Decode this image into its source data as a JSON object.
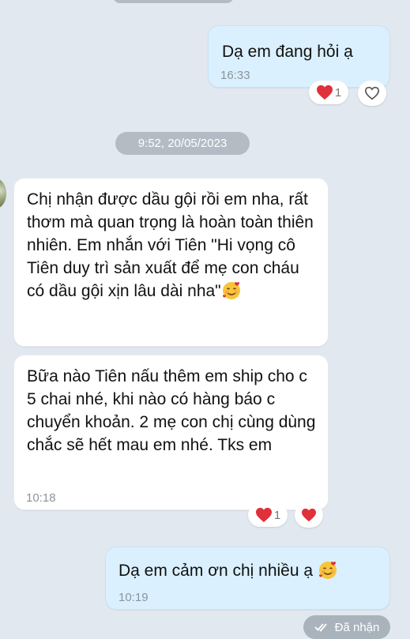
{
  "messages": {
    "m1": {
      "text": "Dạ em đang hỏi ạ",
      "time": "16:33",
      "reaction_count": "1"
    },
    "date_separator": "9:52, 20/05/2023",
    "m2": {
      "text": "Chị nhận được dầu gội rồi em nha, rất thơm mà quan trọng là hoàn toàn thiên nhiên. Em nhắn với Tiên \"Hi vọng cô Tiên duy trì sản xuất để mẹ con cháu có dầu gội xịn lâu dài nha\""
    },
    "m3": {
      "text": "Bữa nào Tiên nấu thêm em ship cho c 5 chai nhé, khi nào có hàng báo c chuyển khoản. 2 mẹ con chị cùng dùng chắc sẽ hết mau em nhé. Tks em",
      "time": "10:18",
      "reaction_count": "1"
    },
    "m4": {
      "text": "Dạ em cảm ơn chị nhiều ạ",
      "time": "10:19"
    },
    "status": "Đã nhận"
  },
  "colors": {
    "background": "#e2e8ef",
    "outgoing_bubble": "#daf0fe",
    "incoming_bubble": "#ffffff",
    "heart": "#e0303a",
    "pill": "#b3bcc5"
  },
  "icons": [
    "heart-icon",
    "heart-outline-icon",
    "smiling-hearts-emoji",
    "double-check-icon"
  ]
}
